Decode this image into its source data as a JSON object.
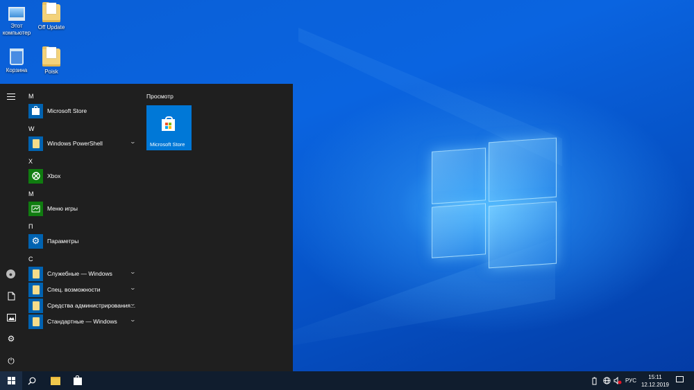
{
  "desktop": {
    "icons": [
      {
        "label": "Этот компьютер",
        "icon": "computer-icon"
      },
      {
        "label": "Off Update",
        "icon": "folder-icon"
      },
      {
        "label": "Корзина",
        "icon": "recycle-bin-icon"
      },
      {
        "label": "Poisk",
        "icon": "folder-icon"
      }
    ]
  },
  "start_menu": {
    "sections": [
      {
        "letter": "M",
        "apps": [
          {
            "label": "Microsoft Store",
            "icon": "store-icon",
            "expandable": false
          }
        ]
      },
      {
        "letter": "W",
        "apps": [
          {
            "label": "Windows PowerShell",
            "icon": "folder-icon",
            "expandable": true
          }
        ]
      },
      {
        "letter": "X",
        "apps": [
          {
            "label": "Xbox",
            "icon": "xbox-icon",
            "expandable": false
          }
        ]
      },
      {
        "letter": "М",
        "apps": [
          {
            "label": "Меню игры",
            "icon": "game-bar-icon",
            "expandable": false
          }
        ]
      },
      {
        "letter": "П",
        "apps": [
          {
            "label": "Параметры",
            "icon": "settings-icon",
            "expandable": false
          }
        ]
      },
      {
        "letter": "С",
        "apps": [
          {
            "label": "Служебные — Windows",
            "icon": "folder-icon",
            "expandable": true
          },
          {
            "label": "Спец. возможности",
            "icon": "folder-icon",
            "expandable": true
          },
          {
            "label": "Средства администрирования...",
            "icon": "folder-icon",
            "expandable": true
          },
          {
            "label": "Стандартные — Windows",
            "icon": "folder-icon",
            "expandable": true
          }
        ]
      }
    ],
    "tiles_section_title": "Просмотр",
    "tiles": [
      {
        "label": "Microsoft Store",
        "icon": "store-icon"
      }
    ],
    "rail_icons": [
      "menu-icon",
      "user-icon",
      "documents-icon",
      "pictures-icon",
      "settings-icon",
      "power-icon"
    ]
  },
  "taskbar": {
    "pinned": [
      "start-icon",
      "search-icon",
      "file-explorer-icon",
      "store-icon"
    ],
    "tray": {
      "language": "РУС",
      "time": "15:11",
      "date": "12.12.2019"
    }
  },
  "colors": {
    "accent": "#0078d7",
    "start_bg": "#1f1f1f",
    "taskbar_bg": "#101d2e",
    "xbox_green": "#107c10"
  }
}
